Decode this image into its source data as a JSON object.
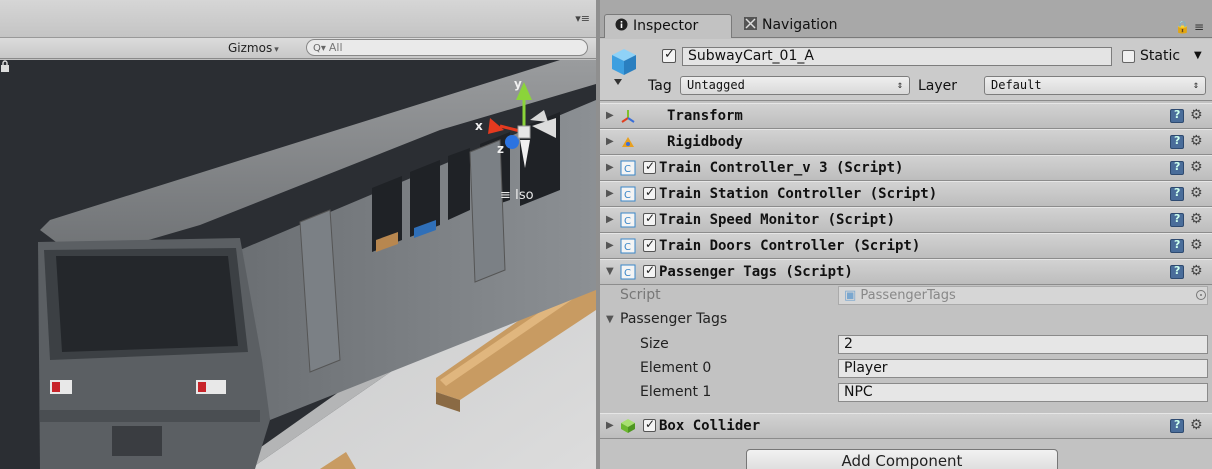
{
  "scene": {
    "toolbar": {
      "gizmos_label": "Gizmos",
      "gizmos_arrow": "▾",
      "search_prefix": "Q▾",
      "search_value": "All"
    },
    "menu_icon": "▾≡",
    "gizmo_axes": {
      "x": "x",
      "y": "y",
      "z": "z"
    },
    "view_mode": "Iso"
  },
  "inspector": {
    "tabs": [
      {
        "label": "Inspector",
        "icon": "info-icon"
      },
      {
        "label": "Navigation",
        "icon": "navigation-icon"
      }
    ],
    "menu_icon": "≡",
    "gameobject": {
      "name": "SubwayCart_01_A",
      "active": true,
      "static_label": "Static",
      "static_checked": false,
      "tag_label": "Tag",
      "tag_value": "Untagged",
      "layer_label": "Layer",
      "layer_value": "Default"
    },
    "components": [
      {
        "title": "Transform",
        "icon": "transform-icon",
        "has_checkbox": false
      },
      {
        "title": "Rigidbody",
        "icon": "rigidbody-icon",
        "has_checkbox": false
      },
      {
        "title": "Train Controller_v 3 (Script)",
        "icon": "script-icon",
        "has_checkbox": true
      },
      {
        "title": "Train Station Controller (Script)",
        "icon": "script-icon",
        "has_checkbox": true
      },
      {
        "title": "Train Speed Monitor (Script)",
        "icon": "script-icon",
        "has_checkbox": true
      },
      {
        "title": "Train Doors Controller (Script)",
        "icon": "script-icon",
        "has_checkbox": true
      },
      {
        "title": "Passenger Tags (Script)",
        "icon": "script-icon",
        "has_checkbox": true,
        "expanded": true
      },
      {
        "title": "Box Collider",
        "icon": "box-collider-icon",
        "has_checkbox": true
      }
    ],
    "passenger_tags": {
      "script_label": "Script",
      "script_value": "PassengerTags",
      "array_label": "Passenger Tags",
      "size_label": "Size",
      "size_value": "2",
      "elements": [
        {
          "label": "Element 0",
          "value": "Player"
        },
        {
          "label": "Element 1",
          "value": "NPC"
        }
      ]
    },
    "add_component_label": "Add Component"
  },
  "colors": {
    "panel_bg": "#c2c2c2",
    "tab_bar": "#a8a8a8",
    "help_blue": "#4a6d9a",
    "axis_x": "#e53a1f",
    "axis_y": "#8bd43a",
    "axis_z": "#2c73e0"
  }
}
